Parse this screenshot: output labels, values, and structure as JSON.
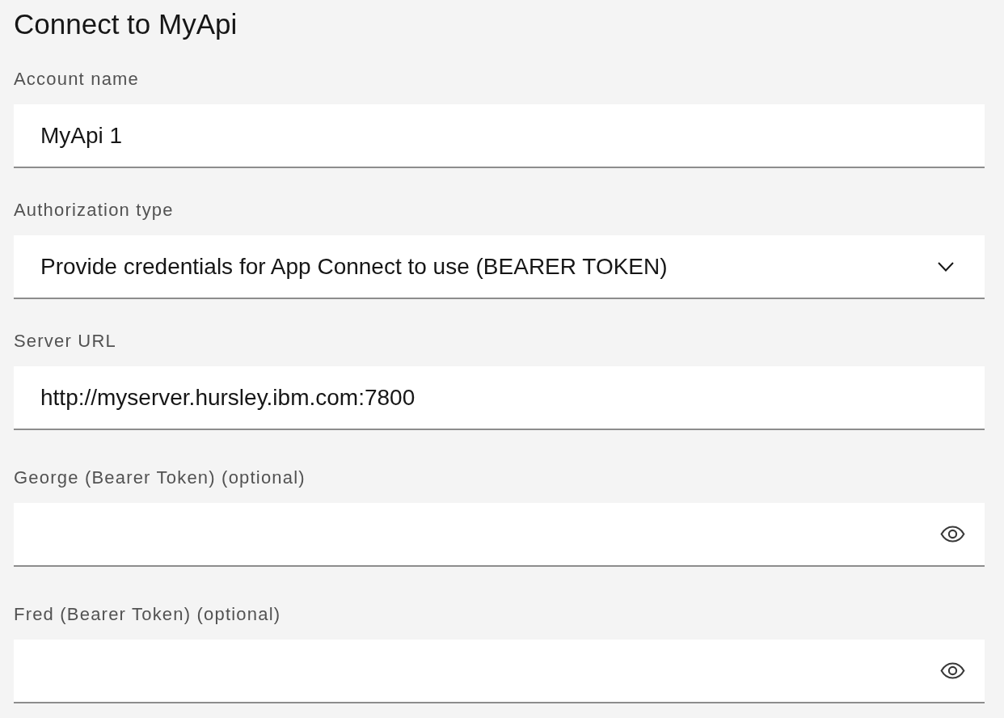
{
  "title": "Connect to MyApi",
  "fields": [
    {
      "kind": "text",
      "label": "Account name",
      "value": "MyApi 1"
    },
    {
      "kind": "select",
      "label": "Authorization type",
      "value": "Provide credentials for App Connect to use (BEARER TOKEN)"
    },
    {
      "kind": "text",
      "label": "Server URL",
      "value": "http://myserver.hursley.ibm.com:7800"
    },
    {
      "kind": "password",
      "label": "George (Bearer Token) (optional)"
    },
    {
      "kind": "password",
      "label": "Fred (Bearer Token) (optional)"
    }
  ]
}
